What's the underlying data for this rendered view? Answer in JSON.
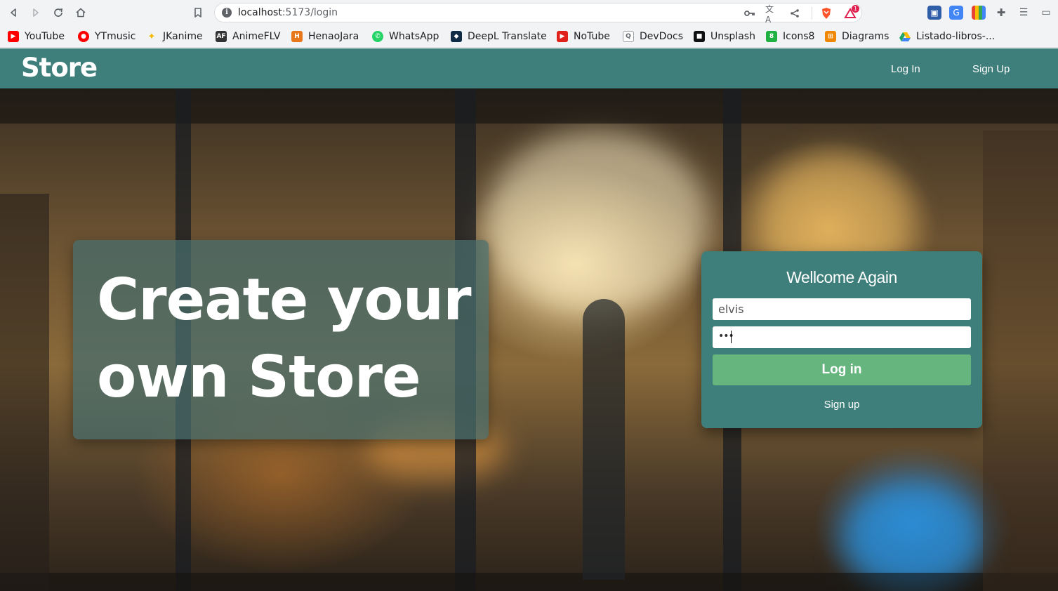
{
  "browser": {
    "url_host": "localhost",
    "url_path": ":5173/login",
    "nav_icons": [
      "back-icon",
      "forward-icon",
      "reload-icon",
      "home-icon",
      "bookmark-icon"
    ],
    "ext_badge": "1",
    "bookmarks": [
      {
        "label": "YouTube",
        "icon": "youtube-icon",
        "color": "#ff0000"
      },
      {
        "label": "YTmusic",
        "icon": "ytmusic-icon",
        "color": "#ff0000"
      },
      {
        "label": "JKanime",
        "icon": "jkanime-icon",
        "color": "#f5b800"
      },
      {
        "label": "AnimeFLV",
        "icon": "animeflv-icon",
        "color": "#333333"
      },
      {
        "label": "HenaoJara",
        "icon": "henaojara-icon",
        "color": "#e8761b"
      },
      {
        "label": "WhatsApp",
        "icon": "whatsapp-icon",
        "color": "#25d366"
      },
      {
        "label": "DeepL Translate",
        "icon": "deepl-icon",
        "color": "#0f2b46"
      },
      {
        "label": "NoTube",
        "icon": "notube-icon",
        "color": "#e0201b"
      },
      {
        "label": "DevDocs",
        "icon": "devdocs-icon",
        "color": "#9aa0a6"
      },
      {
        "label": "Unsplash",
        "icon": "unsplash-icon",
        "color": "#111111"
      },
      {
        "label": "Icons8",
        "icon": "icons8-icon",
        "color": "#1fb141"
      },
      {
        "label": "Diagrams",
        "icon": "diagrams-icon",
        "color": "#f08705"
      },
      {
        "label": "Listado-libros-...",
        "icon": "google-drive-icon",
        "color": "#1fa463"
      }
    ]
  },
  "navbar": {
    "brand": "Store",
    "login_link": "Log  In",
    "signup_link": "Sign Up",
    "color": "#3f7f7b"
  },
  "hero": {
    "tagline_line1": "Create your",
    "tagline_line2": "own Store"
  },
  "login": {
    "title": "Wellcome Again",
    "username_value": "elvis",
    "password_mask": "•••",
    "submit_label": "Log in",
    "signup_label": "Sign up",
    "button_color": "#66b57f"
  }
}
